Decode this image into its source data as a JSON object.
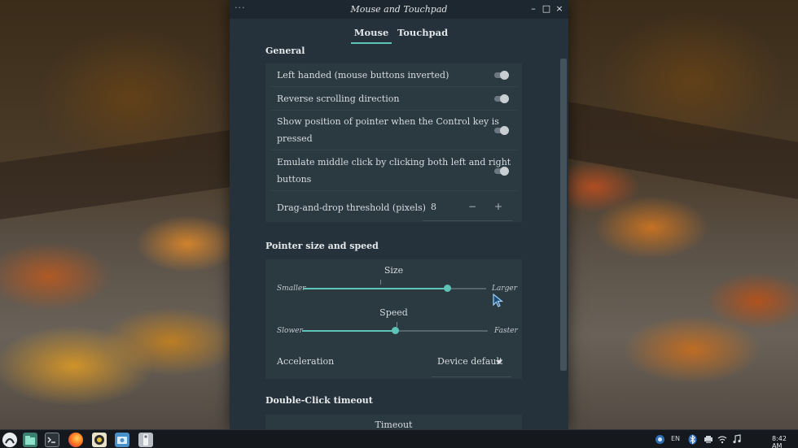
{
  "window": {
    "title": "Mouse and Touchpad",
    "menu_glyph": "···",
    "minimize_glyph": "–",
    "maximize_glyph": "□",
    "close_glyph": "×"
  },
  "tabs": [
    {
      "label": "Mouse",
      "active": true
    },
    {
      "label": "Touchpad",
      "active": false
    }
  ],
  "general": {
    "title": "General",
    "left_handed": {
      "label": "Left handed (mouse buttons inverted)",
      "enabled": false
    },
    "reverse_scroll": {
      "label": "Reverse scrolling direction",
      "enabled": false
    },
    "show_pointer": {
      "label_line1": "Show position of pointer when the Control key is",
      "label_line2": "pressed",
      "enabled": false
    },
    "emulate_middle": {
      "label_line1": "Emulate middle click by clicking both left and right",
      "label_line2": "buttons",
      "enabled": false
    },
    "drag_threshold": {
      "label": "Drag-and-drop threshold (pixels)",
      "value": "8",
      "decrement": "−",
      "increment": "+"
    }
  },
  "pointer": {
    "title": "Pointer size and speed",
    "size": {
      "title": "Size",
      "min_label": "Smaller",
      "max_label": "Larger",
      "fraction": 0.79
    },
    "speed": {
      "title": "Speed",
      "min_label": "Slower",
      "max_label": "Faster",
      "fraction": 0.5
    },
    "acceleration": {
      "label": "Acceleration",
      "value": "Device default"
    }
  },
  "double_click": {
    "title": "Double-Click timeout",
    "timeout_title": "Timeout"
  },
  "colors": {
    "accent": "#5fc4b8",
    "window_bg": "#25323b",
    "card_bg": "#2b3941"
  },
  "taskbar": {
    "apps": [
      "menu-icon",
      "files-icon",
      "terminal-icon",
      "firefox-icon",
      "audio-player-icon",
      "screenshot-icon",
      "usb-drive-icon"
    ],
    "keyboard_layout": "EN",
    "clock": "8:42 AM"
  }
}
